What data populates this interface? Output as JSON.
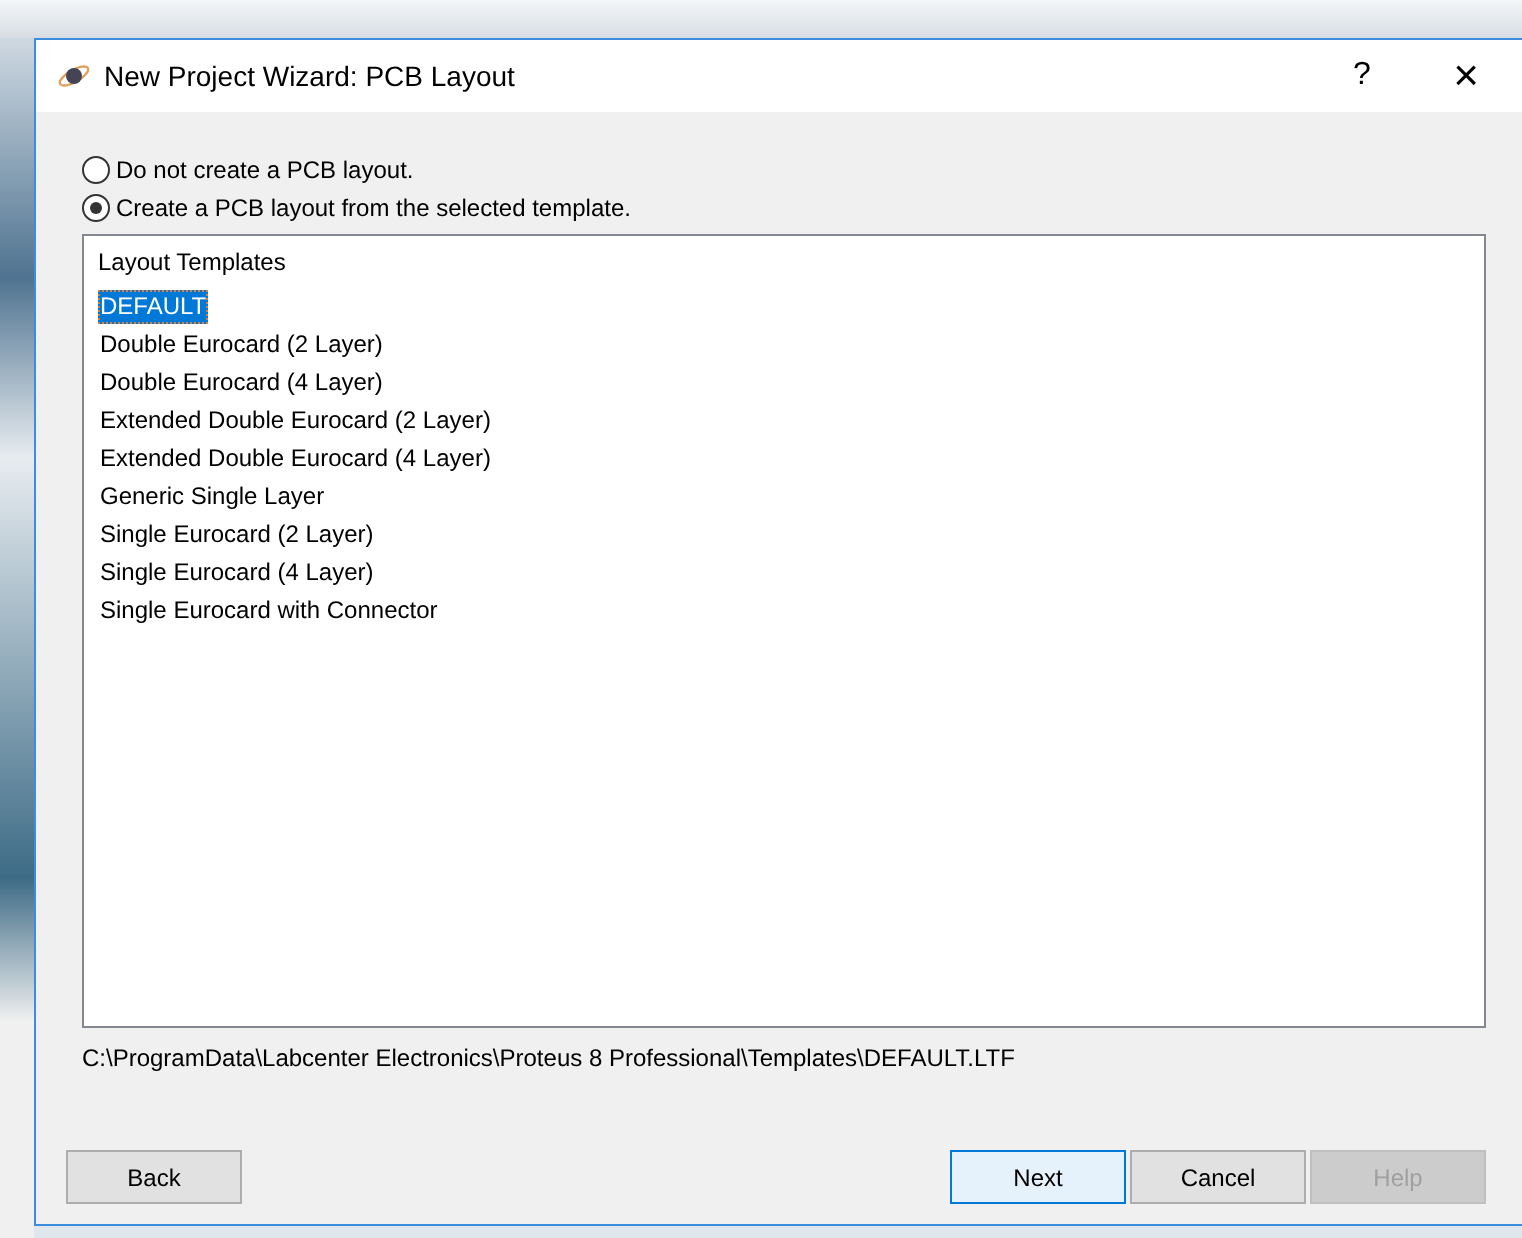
{
  "window": {
    "title": "New Project Wizard: PCB Layout",
    "help_glyph": "?",
    "close_glyph": "×"
  },
  "options": [
    {
      "label": "Do not create a PCB layout.",
      "selected": false
    },
    {
      "label": "Create a PCB layout from the selected template.",
      "selected": true
    }
  ],
  "templates": {
    "heading": "Layout Templates",
    "items": [
      {
        "label": "DEFAULT",
        "selected": true
      },
      {
        "label": "Double Eurocard (2 Layer)",
        "selected": false
      },
      {
        "label": "Double Eurocard (4 Layer)",
        "selected": false
      },
      {
        "label": "Extended Double Eurocard (2 Layer)",
        "selected": false
      },
      {
        "label": "Extended Double Eurocard (4 Layer)",
        "selected": false
      },
      {
        "label": "Generic Single Layer",
        "selected": false
      },
      {
        "label": "Single Eurocard (2 Layer)",
        "selected": false
      },
      {
        "label": "Single Eurocard (4 Layer)",
        "selected": false
      },
      {
        "label": "Single Eurocard with Connector",
        "selected": false
      }
    ]
  },
  "path": "C:\\ProgramData\\Labcenter Electronics\\Proteus 8 Professional\\Templates\\DEFAULT.LTF",
  "buttons": [
    {
      "label": "Back",
      "kind": "normal",
      "disabled": false,
      "default": false
    },
    {
      "label": "Next",
      "kind": "normal",
      "disabled": false,
      "default": true
    },
    {
      "label": "Cancel",
      "kind": "normal",
      "disabled": false,
      "default": false
    },
    {
      "label": "Help",
      "kind": "normal",
      "disabled": true,
      "default": false
    }
  ]
}
